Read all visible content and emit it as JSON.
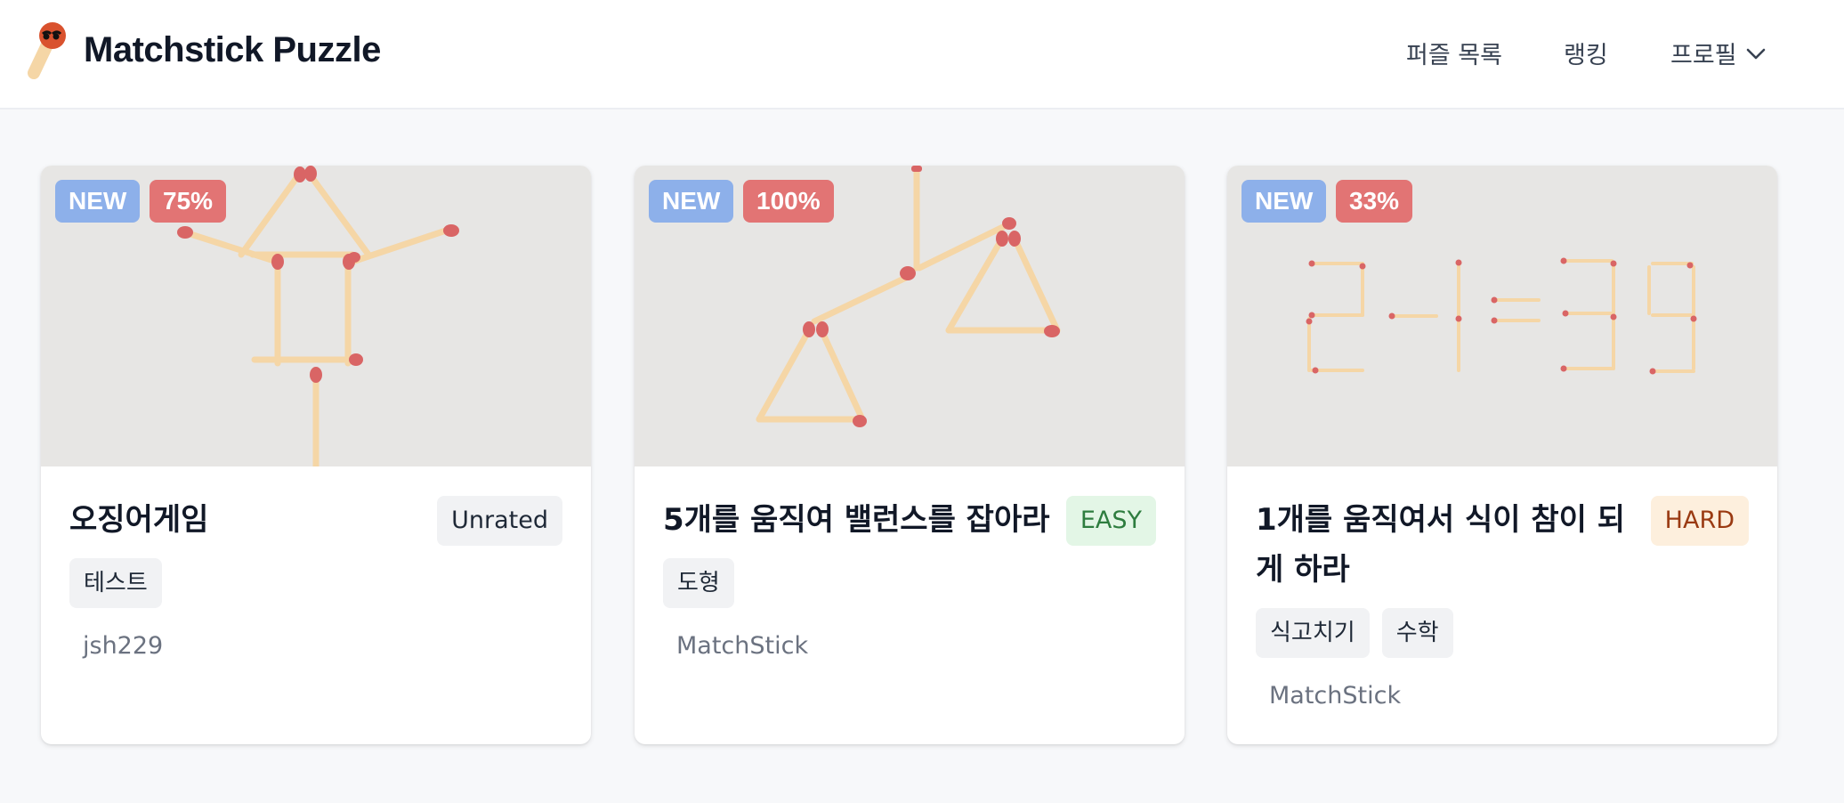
{
  "app": {
    "title": "Matchstick Puzzle"
  },
  "nav": {
    "puzzles": "퍼즐 목록",
    "ranking": "랭킹",
    "profile": "프로필"
  },
  "colors": {
    "thumbnail_bg": "#e7e6e4",
    "stick": "#f5d6a6",
    "match_head": "#d96565",
    "badge_new": "#8db0ea",
    "badge_percent": "#e27474"
  },
  "icons": {
    "logo": "matchstick-logo-icon",
    "profile_menu": "chevron-down-icon"
  },
  "puzzles": [
    {
      "badge_new": "NEW",
      "percent": "75%",
      "title": "오징어게임",
      "level": "Unrated",
      "tags": [
        "테스트"
      ],
      "author": "jsh229"
    },
    {
      "badge_new": "NEW",
      "percent": "100%",
      "title": "5개를 움직여 밸런스를 잡아라",
      "level": "EASY",
      "tags": [
        "도형"
      ],
      "author": "MatchStick"
    },
    {
      "badge_new": "NEW",
      "percent": "33%",
      "title": "1개를 움직여서 식이 참이 되게 하라",
      "level": "HARD",
      "tags": [
        "식고치기",
        "수학"
      ],
      "author": "MatchStick"
    }
  ]
}
